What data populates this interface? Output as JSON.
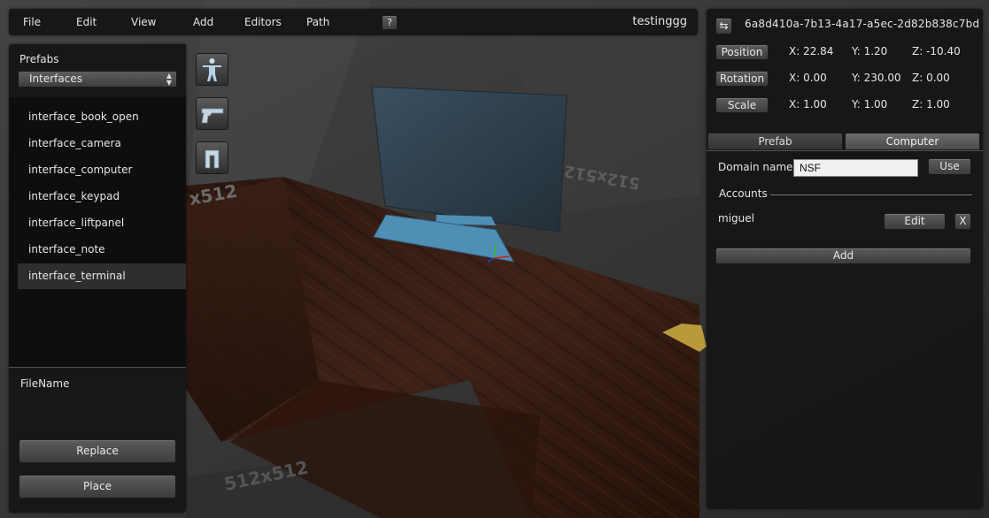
{
  "menubar": {
    "items": [
      "File",
      "Edit",
      "View",
      "Add",
      "Editors",
      "Path"
    ],
    "help_label": "?",
    "project_name": "testinggg"
  },
  "left_panel": {
    "title": "Prefabs",
    "category_select": "Interfaces",
    "items": [
      "interface_book_open",
      "interface_camera",
      "interface_computer",
      "interface_keypad",
      "interface_liftpanel",
      "interface_note",
      "interface_terminal"
    ],
    "selected_item": "interface_terminal",
    "filename_label": "FileName",
    "replace_label": "Replace",
    "place_label": "Place",
    "tool_icons": [
      "character-icon",
      "pistol-icon",
      "magnet-icon"
    ]
  },
  "viewport": {
    "texture_labels": [
      "x512",
      "512x512",
      "512x512"
    ]
  },
  "right_panel": {
    "uuid": "6a8d410a-7b13-4a17-a5ec-2d82b838c7bd",
    "transform": {
      "position": {
        "label": "Position",
        "x": "X: 22.84",
        "y": "Y: 1.20",
        "z": "Z: -10.40"
      },
      "rotation": {
        "label": "Rotation",
        "x": "X: 0.00",
        "y": "Y: 230.00",
        "z": "Z: 0.00"
      },
      "scale": {
        "label": "Scale",
        "x": "X: 1.00",
        "y": "Y: 1.00",
        "z": "Z: 1.00"
      }
    },
    "tabs": [
      "Prefab",
      "Computer"
    ],
    "active_tab": "Computer",
    "domain_label": "Domain name",
    "domain_value": "NSF",
    "use_label": "Use",
    "accounts_label": "Accounts",
    "accounts": [
      {
        "name": "miguel",
        "edit_label": "Edit",
        "remove_label": "X"
      }
    ],
    "add_label": "Add"
  },
  "colors": {
    "panel": "#161616",
    "list_bg": "#0e0e0e",
    "selected_row": "#2e2e2e",
    "monitor": "#33495a",
    "keyboard": "#4f8fb6",
    "desk": "#3a1e14"
  }
}
